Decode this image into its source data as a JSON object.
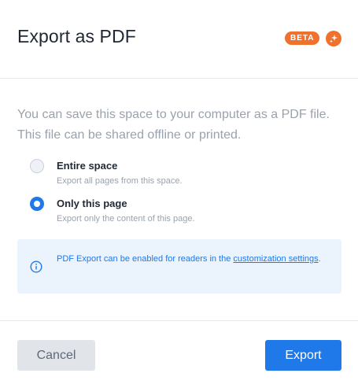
{
  "dialog": {
    "title": "Export as PDF",
    "badge": "BETA",
    "badge_icon": "sparkle-icon",
    "accent_color": "#f0712c"
  },
  "intro": {
    "text": "You can save this space to your computer as a PDF file. This file can be shared offline or printed."
  },
  "options": [
    {
      "label": "Entire space",
      "description": "Export all pages from this space.",
      "selected": false
    },
    {
      "label": "Only this page",
      "description": "Export only the content of this page.",
      "selected": true
    }
  ],
  "info": {
    "icon": "info-icon",
    "text_before": "PDF Export can be enabled for readers in the ",
    "link_label": "customization settings",
    "text_after": "."
  },
  "footer": {
    "cancel_label": "Cancel",
    "export_label": "Export",
    "primary_color": "#2079e8"
  }
}
